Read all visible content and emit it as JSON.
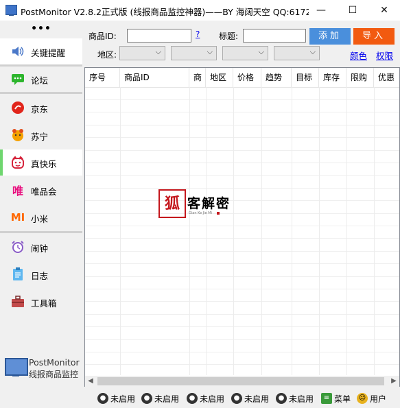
{
  "window": {
    "title": "PostMonitor V2.8.2正式版 (线报商品监控神器)——BY 海阔天空 QQ:6172...",
    "minimize_glyph": "—",
    "maximize_glyph": "☐",
    "close_glyph": "✕"
  },
  "sidebar": {
    "more": "•••",
    "items": [
      {
        "label": "关键提醒",
        "icon": "speaker-icon"
      },
      {
        "label": "论坛",
        "icon": "chat-icon"
      },
      {
        "label": "京东",
        "icon": "jd-logo-icon"
      },
      {
        "label": "苏宁",
        "icon": "suning-logo-icon"
      },
      {
        "label": "真快乐",
        "icon": "zhenkuaile-logo-icon"
      },
      {
        "label": "唯品会",
        "icon": "vip-logo-icon"
      },
      {
        "label": "小米",
        "icon": "mi-logo-icon"
      },
      {
        "label": "闹钟",
        "icon": "alarm-clock-icon"
      },
      {
        "label": "日志",
        "icon": "log-icon"
      },
      {
        "label": "工具箱",
        "icon": "toolbox-icon"
      }
    ],
    "brand_name": "PostMonitor",
    "brand_sub": "线报商品监控"
  },
  "toolbar": {
    "product_id_label": "商品ID:",
    "product_id_value": "",
    "help_link": "?",
    "title_label": "标题:",
    "title_value": "",
    "add_button": "添加",
    "import_button": "导入",
    "region_label": "地区:",
    "color_link": "颜色",
    "permission_link": "权限"
  },
  "grid": {
    "columns": [
      "序号",
      "商品ID",
      "商",
      "地区",
      "价格",
      "趋势",
      "目标",
      "库存",
      "限购",
      "优惠"
    ],
    "rows": []
  },
  "watermark": {
    "seal_char": "狐",
    "text": "客解密",
    "sub": "Gian Ke Jie Mi"
  },
  "statusbar": {
    "items": [
      {
        "label": "未启用",
        "icon": "wechat-icon"
      },
      {
        "label": "未启用",
        "icon": "wechat-icon"
      },
      {
        "label": "未启用",
        "icon": "qq-penguin-icon"
      },
      {
        "label": "未启用",
        "icon": "headset-icon"
      },
      {
        "label": "未启用",
        "icon": "dingtalk-icon"
      },
      {
        "label": "菜单",
        "icon": "menu-icon"
      },
      {
        "label": "用户",
        "icon": "user-icon"
      }
    ]
  },
  "colors": {
    "add_button": "#4a8fdc",
    "import_button": "#f25a10",
    "active_indicator": "#6fd66f",
    "link": "#0000ee"
  }
}
